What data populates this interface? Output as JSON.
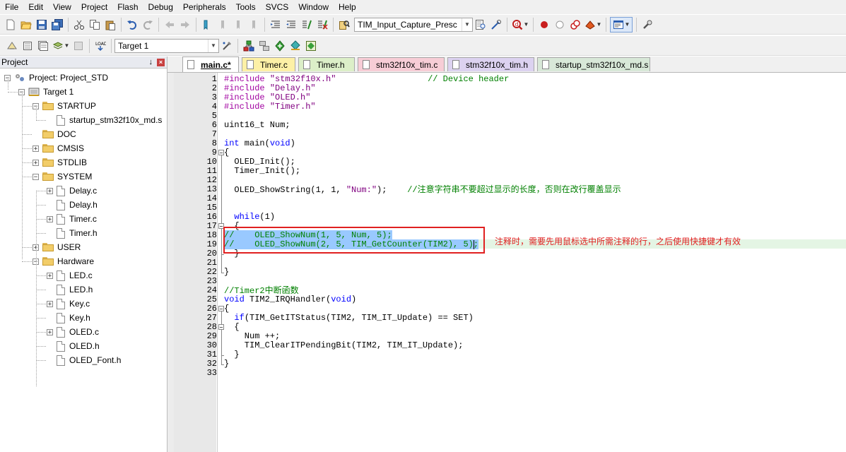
{
  "menubar": [
    "File",
    "Edit",
    "View",
    "Project",
    "Flash",
    "Debug",
    "Peripherals",
    "Tools",
    "SVCS",
    "Window",
    "Help"
  ],
  "toolbar1": {
    "icons": [
      "new-file-icon",
      "open-folder-icon",
      "save-icon",
      "save-all-icon",
      "cut-icon",
      "copy-icon",
      "paste-icon",
      "undo-icon",
      "redo-icon",
      "nav-back-icon",
      "nav-forward-icon",
      "bookmark-icon",
      "bookmark-prev-icon",
      "bookmark-next-icon",
      "bookmark-clear-icon",
      "indent-icon",
      "unindent-icon",
      "comment-icon",
      "uncomment-icon",
      "find-in-files-icon"
    ],
    "find_combo": "TIM_Input_Capture_Presc",
    "icons_after": [
      "find-icon",
      "incremental-find-icon",
      "debug-session-icon",
      "breakpoint-icon",
      "breakpoint-disabled-icon",
      "breakpoint-kill-icon",
      "trace-icon",
      "window-layout-icon",
      "configure-icon"
    ]
  },
  "toolbar2": {
    "icons": [
      "translate-icon",
      "build-icon",
      "rebuild-icon",
      "batch-build-icon",
      "stop-build-icon",
      "load-icon"
    ],
    "target_combo": "Target 1",
    "icons_after": [
      "target-options-icon",
      "manage-project-icon",
      "file-extensions-icon",
      "manage-runtime-icon",
      "select-pack-icon",
      "pack-installer-icon"
    ]
  },
  "project_panel": {
    "title": "Project",
    "tree": [
      {
        "label": "Project: Project_STD",
        "level": 0,
        "kind": "project",
        "expander": "−"
      },
      {
        "label": "Target 1",
        "level": 1,
        "kind": "target",
        "expander": "−"
      },
      {
        "label": "STARTUP",
        "level": 2,
        "kind": "folder",
        "expander": "−"
      },
      {
        "label": "startup_stm32f10x_md.s",
        "level": 3,
        "kind": "file",
        "expander": ""
      },
      {
        "label": "DOC",
        "level": 2,
        "kind": "folder",
        "expander": ""
      },
      {
        "label": "CMSIS",
        "level": 2,
        "kind": "folder",
        "expander": "+"
      },
      {
        "label": "STDLIB",
        "level": 2,
        "kind": "folder",
        "expander": "+"
      },
      {
        "label": "SYSTEM",
        "level": 2,
        "kind": "folder",
        "expander": "−"
      },
      {
        "label": "Delay.c",
        "level": 3,
        "kind": "file",
        "expander": "+"
      },
      {
        "label": "Delay.h",
        "level": 3,
        "kind": "file",
        "expander": ""
      },
      {
        "label": "Timer.c",
        "level": 3,
        "kind": "file",
        "expander": "+"
      },
      {
        "label": "Timer.h",
        "level": 3,
        "kind": "file",
        "expander": ""
      },
      {
        "label": "USER",
        "level": 2,
        "kind": "folder",
        "expander": "+"
      },
      {
        "label": "Hardware",
        "level": 2,
        "kind": "folder",
        "expander": "−"
      },
      {
        "label": "LED.c",
        "level": 3,
        "kind": "file",
        "expander": "+"
      },
      {
        "label": "LED.h",
        "level": 3,
        "kind": "file",
        "expander": ""
      },
      {
        "label": "Key.c",
        "level": 3,
        "kind": "file",
        "expander": "+"
      },
      {
        "label": "Key.h",
        "level": 3,
        "kind": "file",
        "expander": ""
      },
      {
        "label": "OLED.c",
        "level": 3,
        "kind": "file",
        "expander": "+"
      },
      {
        "label": "OLED.h",
        "level": 3,
        "kind": "file",
        "expander": ""
      },
      {
        "label": "OLED_Font.h",
        "level": 3,
        "kind": "file",
        "expander": ""
      }
    ]
  },
  "tabs": [
    {
      "label": "main.c*",
      "color": "#ffffff",
      "active": true
    },
    {
      "label": "Timer.c",
      "color": "#fdf0a6",
      "active": false
    },
    {
      "label": "Timer.h",
      "color": "#dcefc8",
      "active": false
    },
    {
      "label": "stm32f10x_tim.c",
      "color": "#f7cdd6",
      "active": false
    },
    {
      "label": "stm32f10x_tim.h",
      "color": "#dcd2f0",
      "active": false
    },
    {
      "label": "startup_stm32f10x_md.s",
      "color": "#d8e8d8",
      "active": false
    }
  ],
  "code_lines": [
    "#include \"stm32f10x.h\"                  // Device header",
    "#include \"Delay.h\"",
    "#include \"OLED.h\"",
    "#include \"Timer.h\"",
    "",
    "uint16_t Num;",
    "",
    "int main(void)",
    "{",
    "  OLED_Init();",
    "  Timer_Init();",
    "",
    "  OLED_ShowString(1, 1, \"Num:\");    //注意字符串不要超过显示的长度，否则在改行覆盖显示",
    "",
    "",
    "  while(1)",
    "  {",
    "//    OLED_ShowNum(1, 5, Num, 5);",
    "//    OLED_ShowNum(2, 5, TIM_GetCounter(TIM2), 5);",
    "  }",
    "",
    "}",
    "",
    "//Timer2中断函数",
    "void TIM2_IRQHandler(void)",
    "{",
    "  if(TIM_GetITStatus(TIM2, TIM_IT_Update) == SET)",
    "  {",
    "    Num ++;",
    "    TIM_ClearITPendingBit(TIM2, TIM_IT_Update);",
    "  }",
    "}",
    ""
  ],
  "annotation": "注释时，需要先用鼠标选中所需注释的行，之后使用快捷键才有效",
  "colors": {
    "keyword": "#0000ff",
    "preproc": "#a000a0",
    "string": "#800080",
    "comment": "#008000",
    "selection": "#99c9ff",
    "annotation": "#e02020"
  }
}
